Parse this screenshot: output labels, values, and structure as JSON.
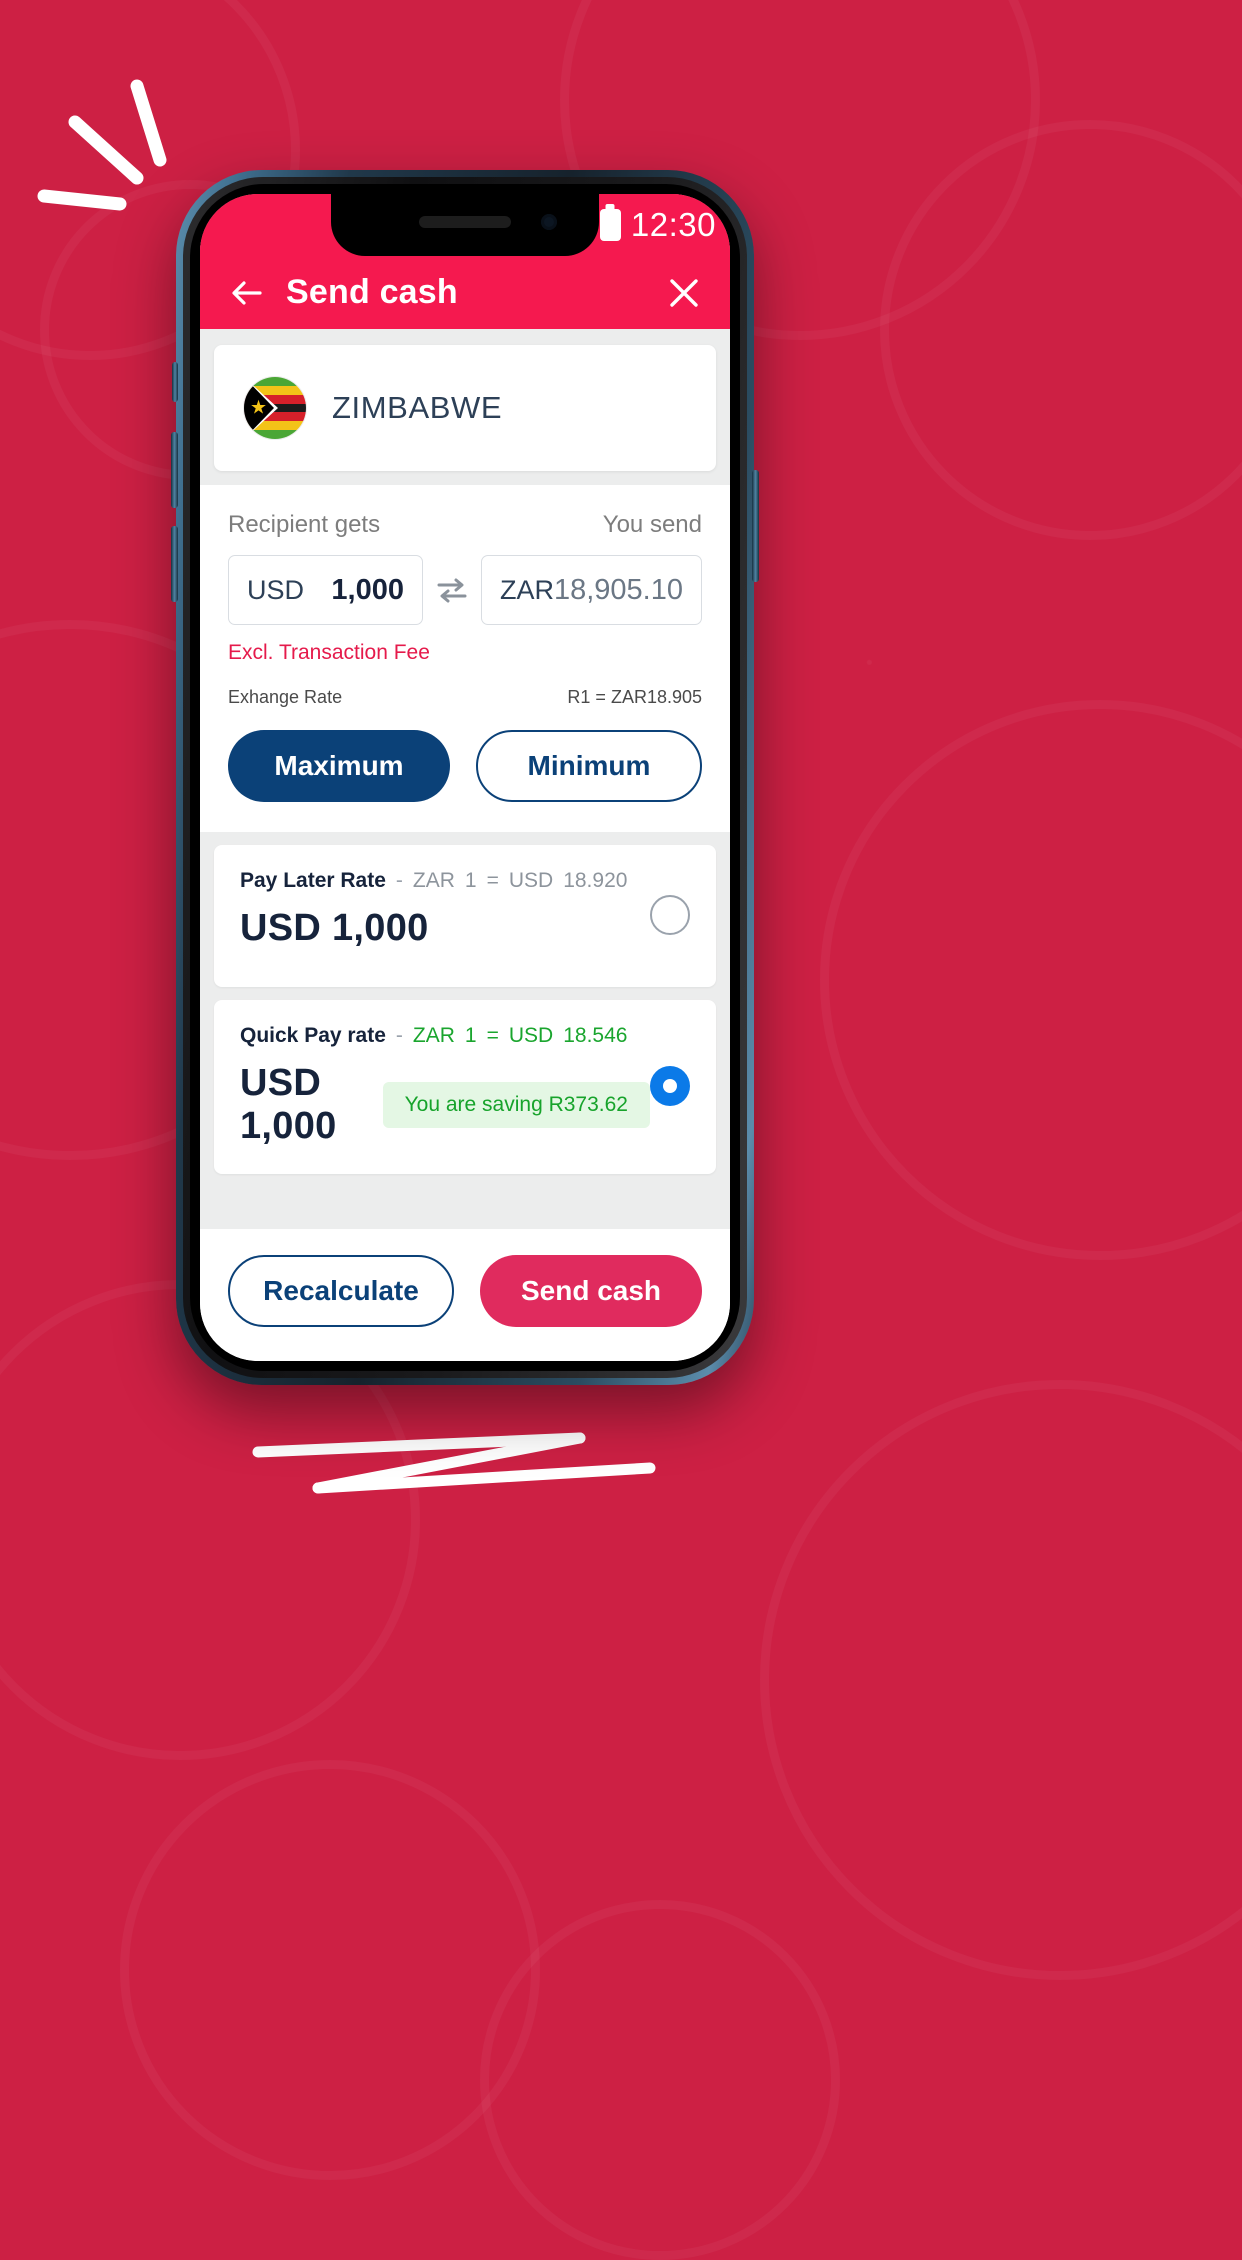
{
  "background": {
    "color": "#cd2044",
    "accent_color": "#ffffff"
  },
  "statusbar": {
    "time": "12:30",
    "battery_icon": "battery-icon"
  },
  "header": {
    "title": "Send cash",
    "back_icon": "back-arrow-icon",
    "close_icon": "close-icon",
    "color": "#f5194f"
  },
  "country": {
    "name": "ZIMBABWE",
    "flag_icon": "zimbabwe-flag-icon"
  },
  "converter": {
    "recipient_label": "Recipient gets",
    "send_label": "You send",
    "recipient_currency": "USD",
    "recipient_amount": "1,000",
    "send_currency": "ZAR",
    "send_amount": "18,905.10",
    "swap_icon": "swap-arrows-icon",
    "fee_note": "Excl. Transaction Fee",
    "fee_note_color": "#e51a4b",
    "exchange_rate_label": "Exhange Rate",
    "exchange_rate_value": "R1 = ZAR18.905",
    "maximum_label": "Maximum",
    "minimum_label": "Minimum",
    "primary_color": "#0b4178"
  },
  "rate_options": [
    {
      "name": "Pay Later Rate",
      "separator": "-",
      "rate_from_currency": "ZAR",
      "rate_from_value": "1",
      "equals": "=",
      "rate_to_currency": "USD",
      "rate_to_value": "18.920",
      "amount": "USD 1,000",
      "badge": "",
      "selected": false,
      "rate_color": "#8d949c"
    },
    {
      "name": "Quick Pay rate",
      "separator": "-",
      "rate_from_currency": "ZAR",
      "rate_from_value": "1",
      "equals": "=",
      "rate_to_currency": "USD",
      "rate_to_value": "18.546",
      "amount": "USD 1,000",
      "badge": "You are saving R373.62",
      "selected": true,
      "rate_color": "#1aa52e"
    }
  ],
  "bottom": {
    "recalculate_label": "Recalculate",
    "send_label": "Send cash",
    "send_color": "#e02b5e",
    "outline_color": "#0b4178"
  }
}
